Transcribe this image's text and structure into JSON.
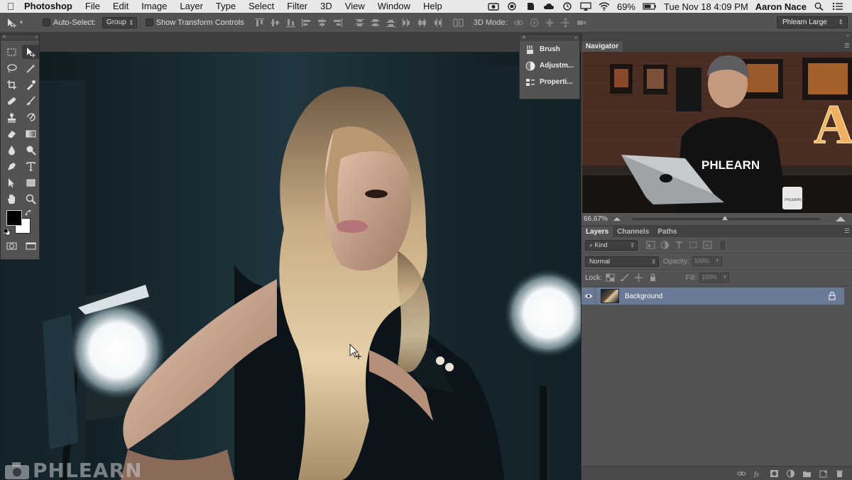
{
  "menubar": {
    "app_name": "Photoshop",
    "menus": [
      "File",
      "Edit",
      "Image",
      "Layer",
      "Type",
      "Select",
      "Filter",
      "3D",
      "View",
      "Window",
      "Help"
    ],
    "battery": "69%",
    "datetime": "Tue Nov 18  4:09 PM",
    "user": "Aaron Nace"
  },
  "options": {
    "auto_select_label": "Auto-Select:",
    "auto_select_value": "Group",
    "show_transform_label": "Show Transform Controls",
    "mode_3d_label": "3D Mode:",
    "workspace": "Phlearn Large"
  },
  "mini_panel": {
    "items": [
      "Brush",
      "Adjustm...",
      "Properti..."
    ]
  },
  "navigator": {
    "tab": "Navigator",
    "zoom": "66.67%",
    "zoom_slider_fraction": 0.48,
    "preview_shirt_text": "PHLEARN",
    "preview_sign_letter": "A",
    "preview_mug_text": "PHLEARN"
  },
  "layers": {
    "tabs": [
      "Layers",
      "Channels",
      "Paths"
    ],
    "filter_kind": "Kind",
    "blend_mode": "Normal",
    "opacity_label": "Opacity:",
    "opacity_value": "100%",
    "lock_label": "Lock:",
    "fill_label": "Fill:",
    "fill_value": "100%",
    "layer_items": [
      {
        "name": "Background",
        "visible": true,
        "locked": true,
        "selected": true
      }
    ]
  },
  "watermark": {
    "text": "PHLEARN"
  },
  "colors": {
    "menubar_bg": "#e8e8e8",
    "panel_bg": "#535353",
    "selected_layer": "#6a7a95"
  }
}
